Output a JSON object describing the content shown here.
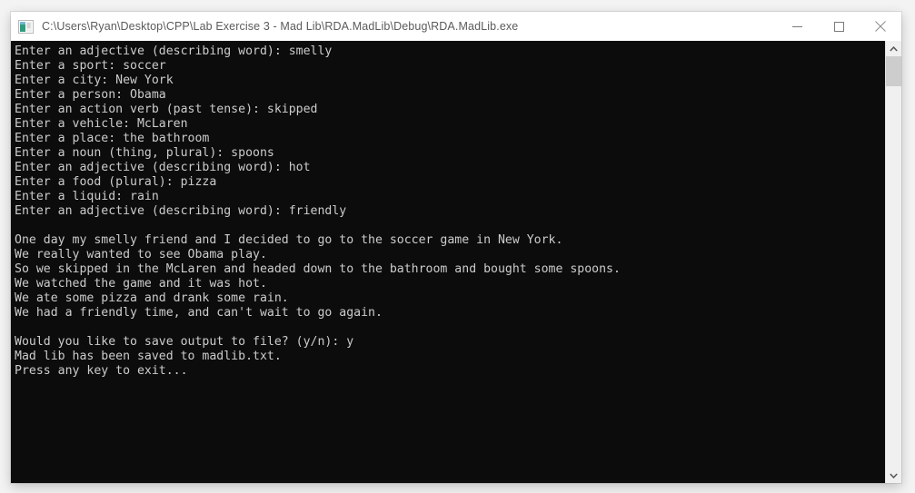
{
  "window": {
    "title": "C:\\Users\\Ryan\\Desktop\\CPP\\Lab Exercise 3 - Mad Lib\\RDA.MadLib\\Debug\\RDA.MadLib.exe",
    "icon_name": "console-app-icon",
    "controls": {
      "minimize_label": "Minimize",
      "maximize_label": "Maximize",
      "close_label": "Close"
    },
    "colors": {
      "titlebar_background": "#ffffff",
      "titlebar_text": "#5b5b5b",
      "console_background": "#0c0c0c",
      "console_text": "#cccccc",
      "scrollbar_track": "#f0f0f0",
      "scrollbar_thumb": "#cdcdcd"
    }
  },
  "console": {
    "lines": [
      "Enter an adjective (describing word): smelly",
      "Enter a sport: soccer",
      "Enter a city: New York",
      "Enter a person: Obama",
      "Enter an action verb (past tense): skipped",
      "Enter a vehicle: McLaren",
      "Enter a place: the bathroom",
      "Enter a noun (thing, plural): spoons",
      "Enter an adjective (describing word): hot",
      "Enter a food (plural): pizza",
      "Enter a liquid: rain",
      "Enter an adjective (describing word): friendly",
      "",
      "One day my smelly friend and I decided to go to the soccer game in New York.",
      "We really wanted to see Obama play.",
      "So we skipped in the McLaren and headed down to the bathroom and bought some spoons.",
      "We watched the game and it was hot.",
      "We ate some pizza and drank some rain.",
      "We had a friendly time, and can't wait to go again.",
      "",
      "Would you like to save output to file? (y/n): y",
      "Mad lib has been saved to madlib.txt.",
      "Press any key to exit..."
    ]
  },
  "scrollbar": {
    "up_arrow_name": "scroll-up-arrow",
    "down_arrow_name": "scroll-down-arrow"
  }
}
